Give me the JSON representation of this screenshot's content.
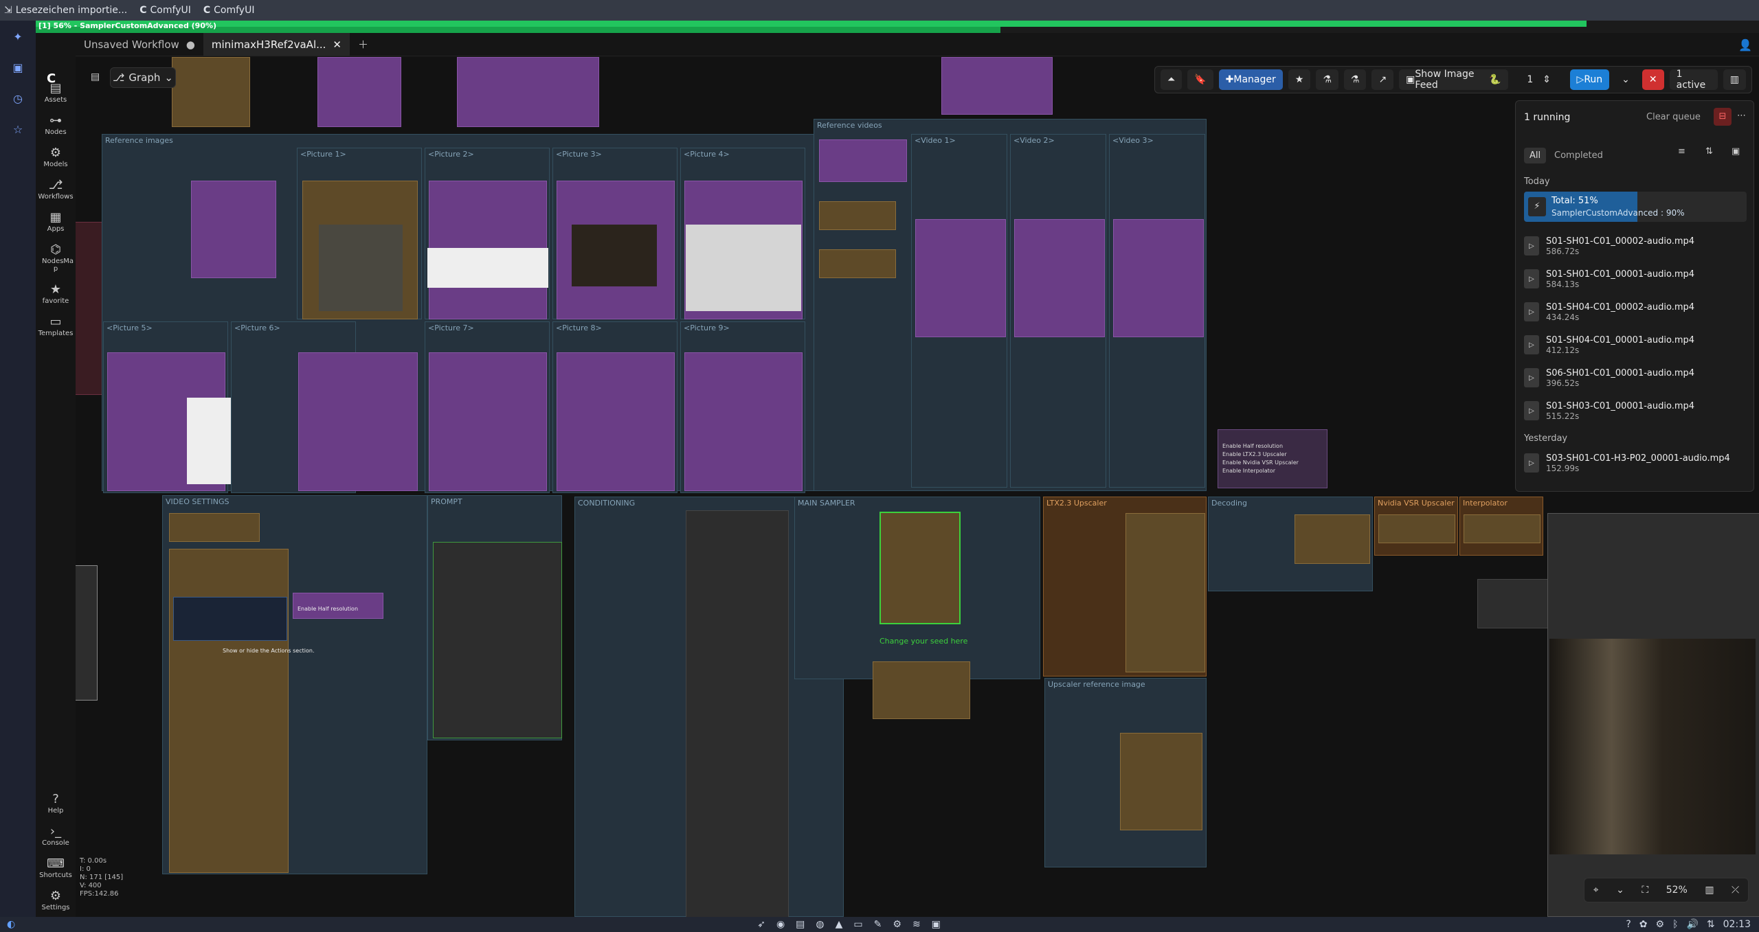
{
  "bookmarks": [
    {
      "icon": "import-icon",
      "label": "Lesezeichen importie..."
    },
    {
      "icon": "comfy-logo",
      "label": "ComfyUI"
    },
    {
      "icon": "comfy-logo",
      "label": "ComfyUI"
    }
  ],
  "progress": {
    "label": "[1] 56% - SamplerCustomAdvanced (90%)",
    "overall_percent": 56,
    "node_percent": 90
  },
  "tabs": [
    {
      "label": "Unsaved Workflow",
      "active": false
    },
    {
      "label": "minimaxH3Ref2vaAl...",
      "active": true
    }
  ],
  "graph_label": "Graph",
  "sidebar": [
    {
      "icon": "assets-icon",
      "label": "Assets"
    },
    {
      "icon": "nodes-icon",
      "label": "Nodes"
    },
    {
      "icon": "models-icon",
      "label": "Models"
    },
    {
      "icon": "workflows-icon",
      "label": "Workflows"
    },
    {
      "icon": "apps-icon",
      "label": "Apps"
    },
    {
      "icon": "nodesmap-icon",
      "label": "NodesMa p"
    },
    {
      "icon": "star-icon",
      "label": "favorite"
    },
    {
      "icon": "templates-icon",
      "label": "Templates"
    }
  ],
  "sidebar_bottom": [
    {
      "icon": "help-icon",
      "label": "Help"
    },
    {
      "icon": "console-icon",
      "label": "Console"
    },
    {
      "icon": "keyboard-icon",
      "label": "Shortcuts"
    },
    {
      "icon": "gear-icon",
      "label": "Settings"
    }
  ],
  "toolbar": {
    "manager": "Manager",
    "show_image_feed": "Show Image Feed",
    "batch_count": "1",
    "run": "Run",
    "active": "1 active"
  },
  "queue": {
    "running": "1 running",
    "clear_queue": "Clear queue",
    "filter_all": "All",
    "filter_completed": "Completed",
    "today": "Today",
    "yesterday": "Yesterday",
    "current": {
      "title": "Total: 51%",
      "subtitle": "SamplerCustomAdvanced : 90%",
      "percent": 51
    },
    "items_today": [
      {
        "name": "S01-SH01-C01_00002-audio.mp4",
        "time": "586.72s"
      },
      {
        "name": "S01-SH01-C01_00001-audio.mp4",
        "time": "584.13s"
      },
      {
        "name": "S01-SH04-C01_00002-audio.mp4",
        "time": "434.24s"
      },
      {
        "name": "S01-SH04-C01_00001-audio.mp4",
        "time": "412.12s"
      },
      {
        "name": "S06-SH01-C01_00001-audio.mp4",
        "time": "396.52s"
      },
      {
        "name": "S01-SH03-C01_00001-audio.mp4",
        "time": "515.22s"
      }
    ],
    "items_yesterday": [
      {
        "name": "S03-SH01-C01-H3-P02_00001-audio.mp4",
        "time": "152.99s"
      }
    ]
  },
  "groups": {
    "reference_images": "Reference images",
    "reference_videos": "Reference videos",
    "video_settings": "VIDEO SETTINGS",
    "prompt": "PROMPT",
    "conditioning": "CONDITIONING",
    "main_sampler": "MAIN SAMPLER",
    "ltx_upscaler": "LTX2.3 Upscaler",
    "decoding": "Decoding",
    "nvidia_vsr": "Nvidia VSR Upscaler",
    "interpolator": "Interpolator",
    "upscaler_reference": "Upscaler reference image",
    "change_seed": "Change your seed here"
  },
  "picture_groups": [
    "<Picture 1>",
    "<Picture 2>",
    "<Picture 3>",
    "<Picture 4>",
    "<Picture 5>",
    "<Picture 6>",
    "<Picture 7>",
    "<Picture 8>",
    "<Picture 9>"
  ],
  "video_groups": [
    "<Video 1>",
    "<Video 2>",
    "<Video 3>"
  ],
  "enable_toggles": [
    "Enable Half resolution",
    "Enable LTX2.3 Upscaler",
    "Enable Nvidia VSR Upscaler",
    "Enable Interpolator"
  ],
  "tooltip": "Show or hide the Actions section.",
  "zoom": "52%",
  "stats": [
    "T: 0.00s",
    "I: 0",
    "N: 171 [145]",
    "V: 400",
    "FPS:142.86"
  ],
  "clock": "02:13",
  "colors": {
    "accent": "#2b5ea8",
    "progress": "#22c55e",
    "group": "#25323d",
    "node_purple": "#6a3d86",
    "node_brown": "#5e4a28"
  }
}
